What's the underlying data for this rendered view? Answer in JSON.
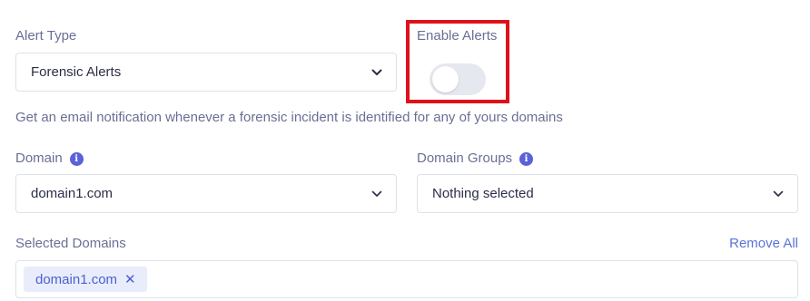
{
  "alert_type": {
    "label": "Alert Type",
    "selected": "Forensic Alerts"
  },
  "enable_alerts": {
    "label": "Enable Alerts",
    "enabled": false
  },
  "help_text": "Get an email notification whenever a forensic incident is identified for any of yours domains",
  "domain": {
    "label": "Domain",
    "selected": "domain1.com"
  },
  "domain_groups": {
    "label": "Domain Groups",
    "selected": "Nothing selected"
  },
  "selected_domains": {
    "label": "Selected Domains",
    "remove_all_label": "Remove All",
    "chips": [
      "domain1.com"
    ]
  },
  "colors": {
    "accent": "#5b61d6",
    "link": "#5b73d9",
    "highlight": "#e0101b",
    "chip_bg": "#e9ecfb"
  }
}
